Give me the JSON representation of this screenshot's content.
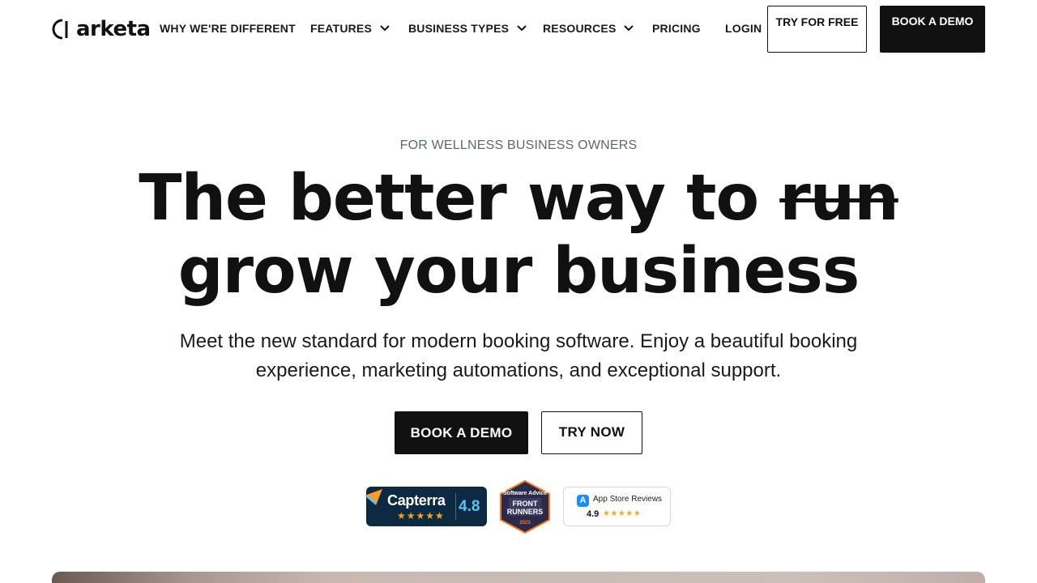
{
  "header": {
    "logo_text": "arketa",
    "nav": [
      {
        "label": "WHY WE'RE DIFFERENT",
        "has_dropdown": false
      },
      {
        "label": "FEATURES",
        "has_dropdown": true
      },
      {
        "label": "BUSINESS TYPES",
        "has_dropdown": true
      },
      {
        "label": "RESOURCES",
        "has_dropdown": true
      },
      {
        "label": "PRICING",
        "has_dropdown": false
      },
      {
        "label": "LOGIN",
        "has_dropdown": false
      }
    ],
    "try_free_label": "TRY FOR FREE",
    "book_demo_label": "BOOK A DEMO"
  },
  "hero": {
    "eyebrow": "FOR WELLNESS BUSINESS OWNERS",
    "headline_prefix": "The better way to",
    "headline_struck": "run",
    "headline_line2": "grow your business",
    "subtext": "Meet the new standard for modern booking software. Enjoy a beautiful booking experience, marketing automations, and exceptional support.",
    "primary_cta": "BOOK A DEMO",
    "secondary_cta": "TRY NOW"
  },
  "badges": {
    "capterra": {
      "name": "Capterra",
      "score": "4.8",
      "stars": 5
    },
    "software_advice": {
      "brand": "Software Advice",
      "line1": "FRONT",
      "line2": "RUNNERS",
      "year": "2023"
    },
    "app_store": {
      "label": "App Store Reviews",
      "score": "4.9",
      "stars": 5
    }
  },
  "colors": {
    "text": "#111111",
    "eyebrow": "#5d6770",
    "capterra_bg": "#0d2a43",
    "capterra_score": "#5bc4f1",
    "star": "#f5a623"
  },
  "icons": {
    "chevron": "chevron-down-icon",
    "star": "star-icon"
  }
}
